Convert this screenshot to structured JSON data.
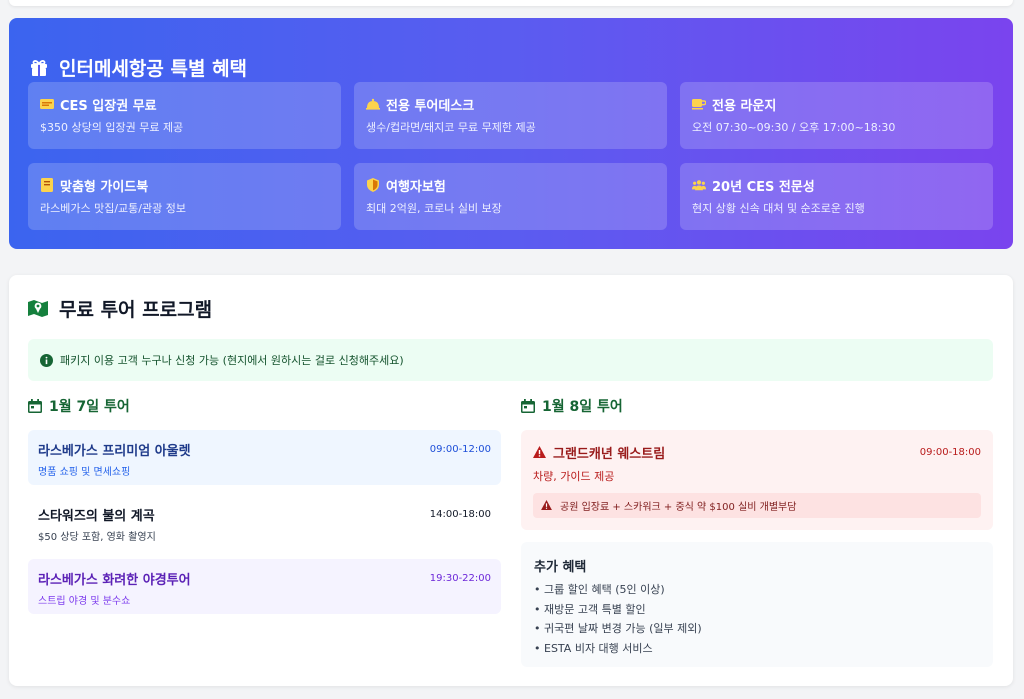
{
  "benefits": {
    "title": "인터메세항공 특별 혜택",
    "cards": [
      {
        "icon": "ticket-icon",
        "title": "CES 입장권 무료",
        "desc": "$350 상당의 입장권 무료 제공"
      },
      {
        "icon": "bell-icon",
        "title": "전용 투어데스크",
        "desc": "생수/컵라면/돼지코 무료 무제한 제공"
      },
      {
        "icon": "coffee-icon",
        "title": "전용 라운지",
        "desc": "오전 07:30~09:30 / 오후 17:00~18:30"
      },
      {
        "icon": "book-icon",
        "title": "맞춤형 가이드북",
        "desc": "라스베가스 맛집/교통/관광 정보"
      },
      {
        "icon": "shield-icon",
        "title": "여행자보험",
        "desc": "최대 2억원, 코로나 실비 보장"
      },
      {
        "icon": "users-icon",
        "title": "20년 CES 전문성",
        "desc": "현지 상황 신속 대처 및 순조로운 진행"
      }
    ]
  },
  "tours": {
    "title": "무료 투어 프로그램",
    "notice": "패키지 이용 고객 누구나 신청 가능 (현지에서 원하시는 걸로 신청해주세요)",
    "day1": {
      "heading": "1월 7일 투어",
      "items": [
        {
          "name": "라스베가스 프리미엄 아울렛",
          "time": "09:00-12:00",
          "desc": "명품 쇼핑 및 면세쇼핑"
        },
        {
          "name": "스타워즈의 불의 계곡",
          "time": "14:00-18:00",
          "desc": "$50 상당 포함, 영화 촬영지"
        },
        {
          "name": "라스베가스 화려한 야경투어",
          "time": "19:30-22:00",
          "desc": "스트립 야경 및 분수쇼"
        }
      ]
    },
    "day2": {
      "heading": "1월 8일 투어",
      "grand_canyon": {
        "name": "그랜드캐년 웨스트림",
        "time": "09:00-18:00",
        "desc": "차량, 가이드 제공",
        "warning": "공원 입장료 + 스카워크 + 중식 약 $100 실비 개별부담"
      },
      "extra": {
        "title": "추가 혜택",
        "items": [
          "그룹 할인 혜택 (5인 이상)",
          "재방문 고객 특별 할인",
          "귀국편 날짜 변경 가능 (일부 제외)",
          "ESTA 비자 대행 서비스"
        ]
      }
    }
  },
  "colors": {
    "gradient_start": "#3b64ef",
    "gradient_end": "#7a44ee",
    "green": "#166534",
    "red": "#991b1b"
  }
}
